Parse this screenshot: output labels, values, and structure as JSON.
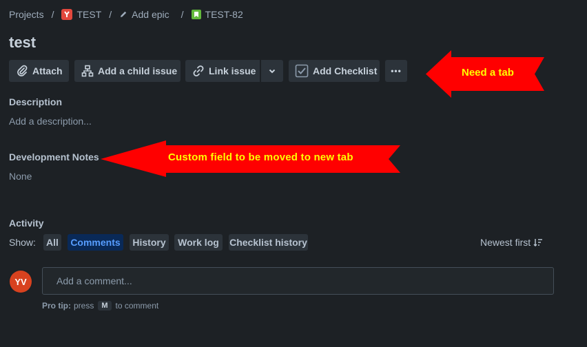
{
  "breadcrumb": {
    "projects": "Projects",
    "project": "TEST",
    "epic": "Add epic",
    "issue_key": "TEST-82",
    "separator": "/"
  },
  "issue": {
    "title": "test"
  },
  "toolbar": {
    "attach": "Attach",
    "add_child": "Add a child issue",
    "link_issue": "Link issue",
    "add_checklist": "Add Checklist",
    "more": "•••"
  },
  "description": {
    "label": "Description",
    "placeholder": "Add a description..."
  },
  "dev_notes": {
    "label": "Development Notes",
    "value": "None"
  },
  "activity": {
    "label": "Activity",
    "show_label": "Show:",
    "filters": [
      "All",
      "Comments",
      "History",
      "Work log",
      "Checklist history"
    ],
    "active_filter": "Comments",
    "sort": "Newest first"
  },
  "comment": {
    "avatar_initials": "YV",
    "placeholder": "Add a comment...",
    "tip_prefix": "Pro tip:",
    "tip_press": "press",
    "tip_key": "M",
    "tip_suffix": "to comment"
  },
  "annotations": {
    "tab_note": "Need a tab",
    "field_note": "Custom field to be moved to new tab"
  },
  "colors": {
    "background": "#1d2125",
    "button": "#2c333a",
    "active_chip_bg": "#092957",
    "active_chip_text": "#579dff",
    "annotation_arrow": "#ff0000",
    "annotation_text": "#ffff00",
    "avatar": "#d8421f"
  }
}
